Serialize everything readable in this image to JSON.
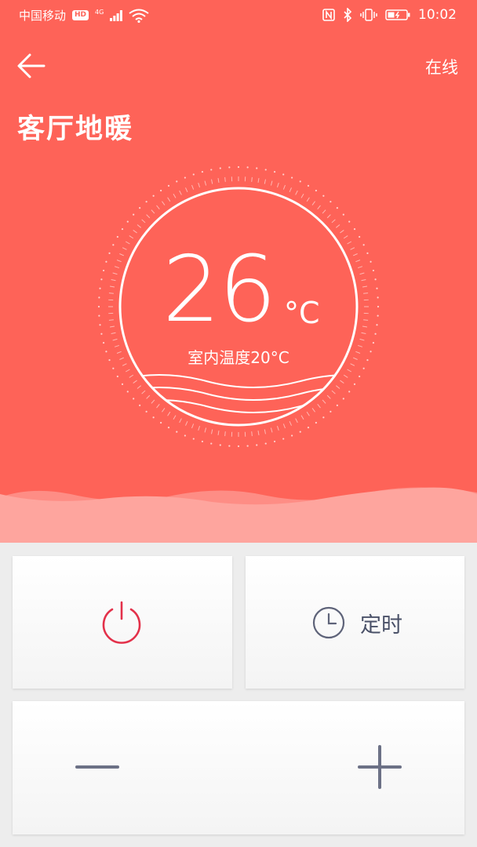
{
  "status_bar": {
    "carrier": "中国移动",
    "hd_badge": "HD",
    "network": "4G",
    "time": "10:02"
  },
  "header": {
    "online_status": "在线",
    "title": "客厅地暖"
  },
  "thermostat": {
    "set_temperature": "26",
    "unit": "°C",
    "indoor_label": "室内温度20°C"
  },
  "controls": {
    "timer_label": "定时"
  },
  "icons": {
    "back": "arrow-left-icon",
    "power": "power-icon",
    "timer": "clock-icon",
    "minus": "minus-icon",
    "plus": "plus-icon"
  },
  "colors": {
    "hero_bg": "#fe6358",
    "wave_light": "#fea59e",
    "power_accent": "#e3314a",
    "icon_gray": "#5e6379",
    "page_bg": "#ededed"
  }
}
